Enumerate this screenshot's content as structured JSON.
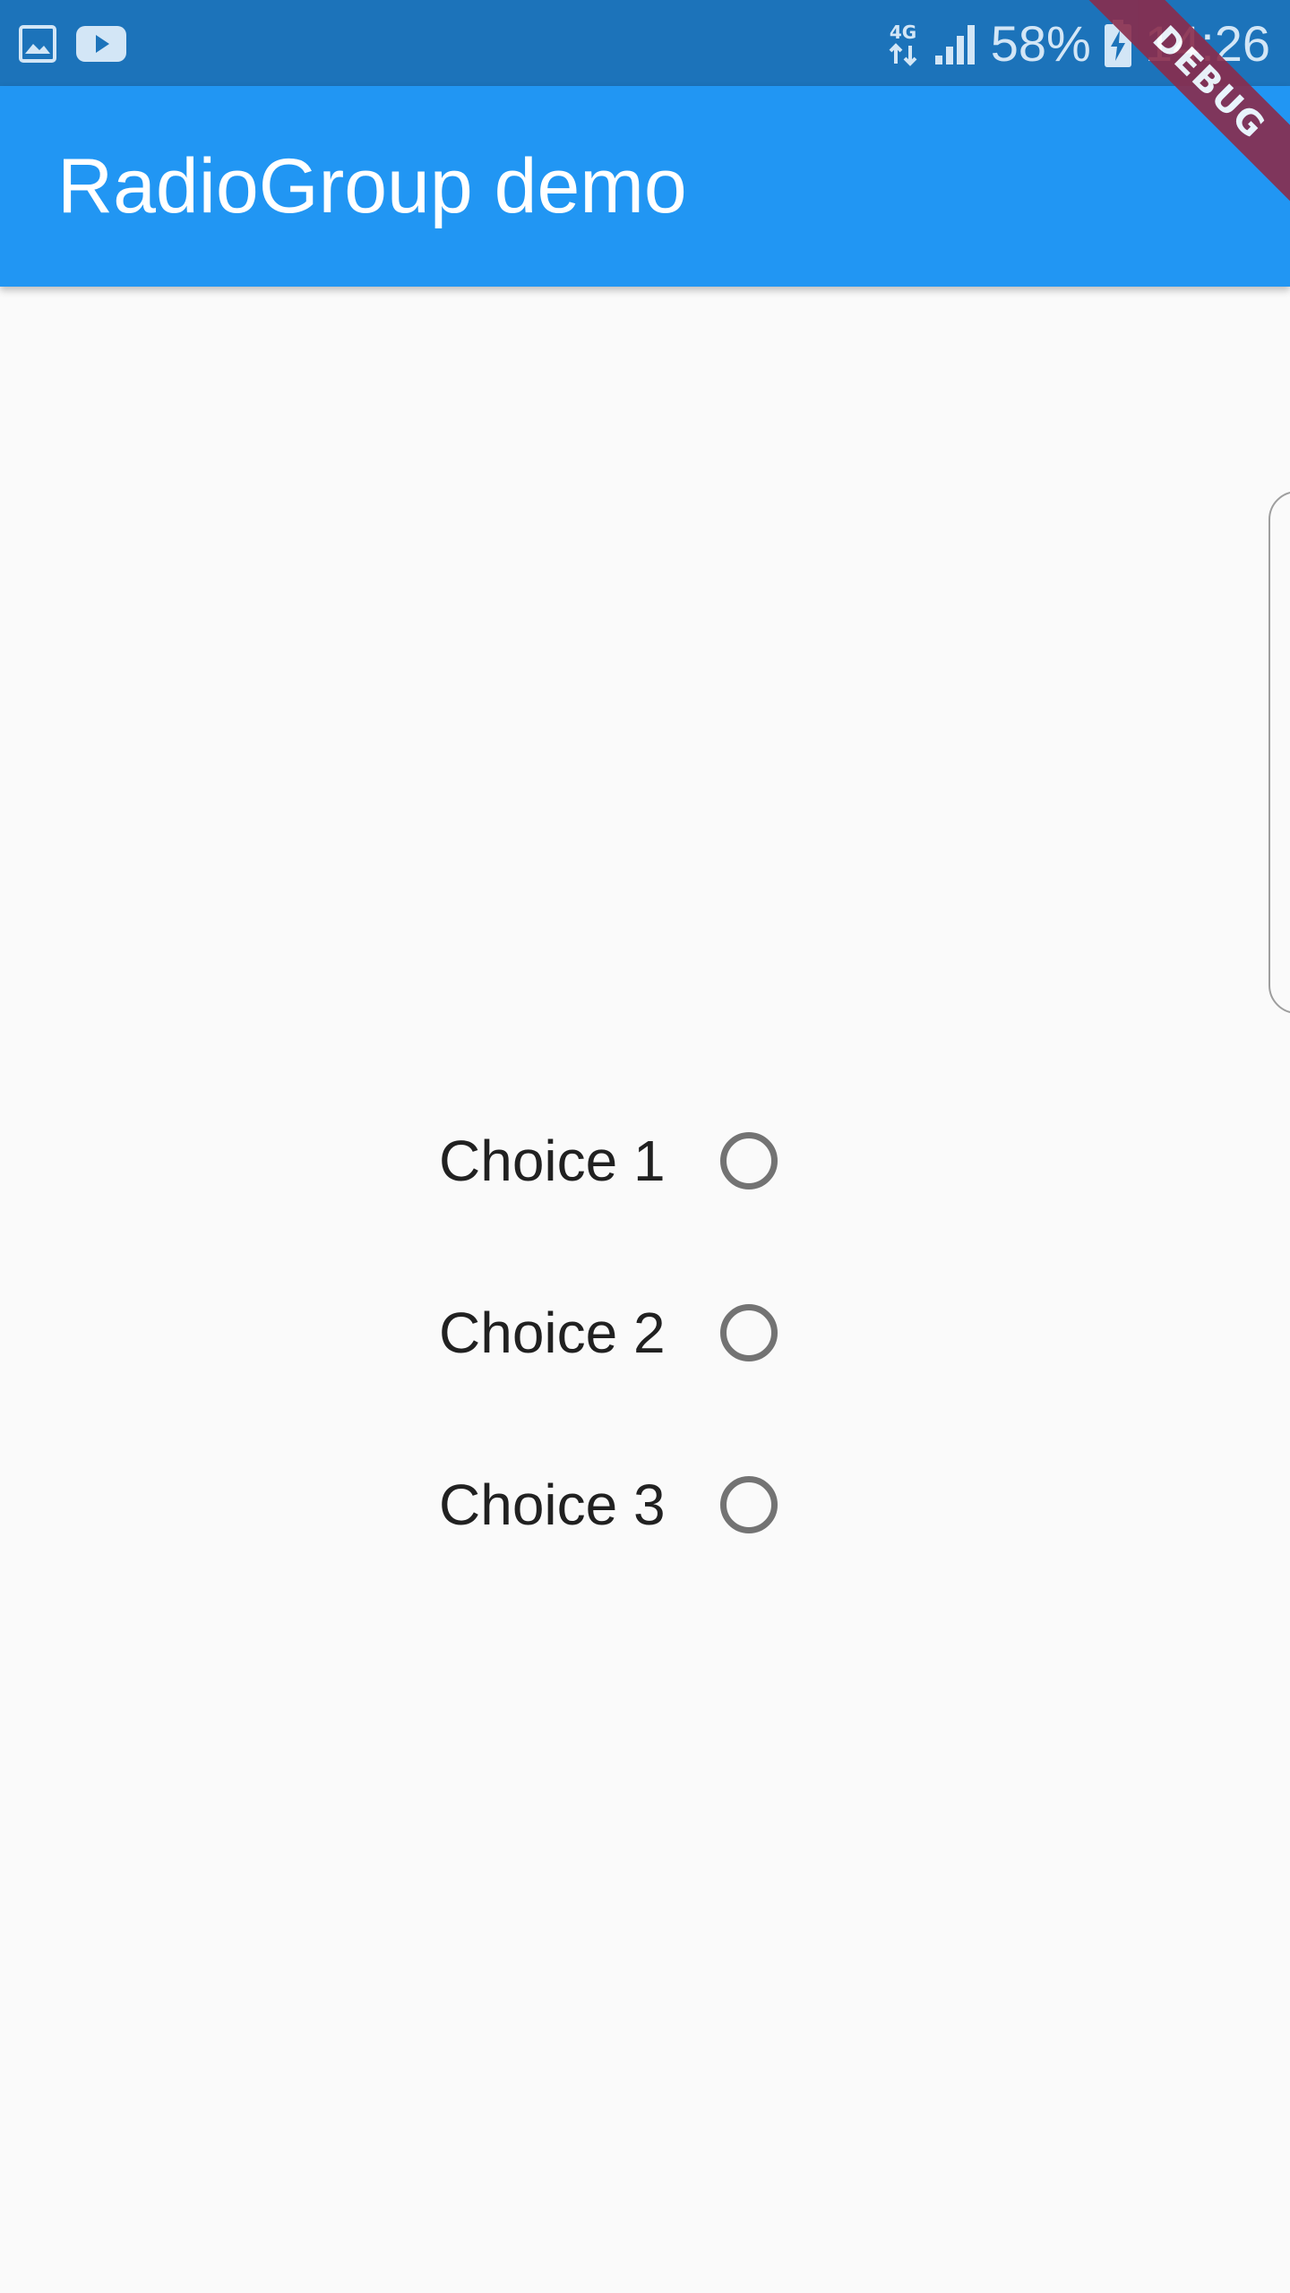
{
  "status_bar": {
    "left_icons": [
      "gallery-icon",
      "youtube-icon"
    ],
    "network": "4G",
    "battery_percent": "58%",
    "time": "14:26",
    "color": "#1c73ba"
  },
  "app_bar": {
    "title": "RadioGroup demo",
    "color": "#2196f3"
  },
  "debug_banner": {
    "label": "DEBUG"
  },
  "radio_group": {
    "choices": [
      {
        "label": "Choice 1",
        "selected": false
      },
      {
        "label": "Choice 2",
        "selected": false
      },
      {
        "label": "Choice 3",
        "selected": false
      }
    ]
  }
}
